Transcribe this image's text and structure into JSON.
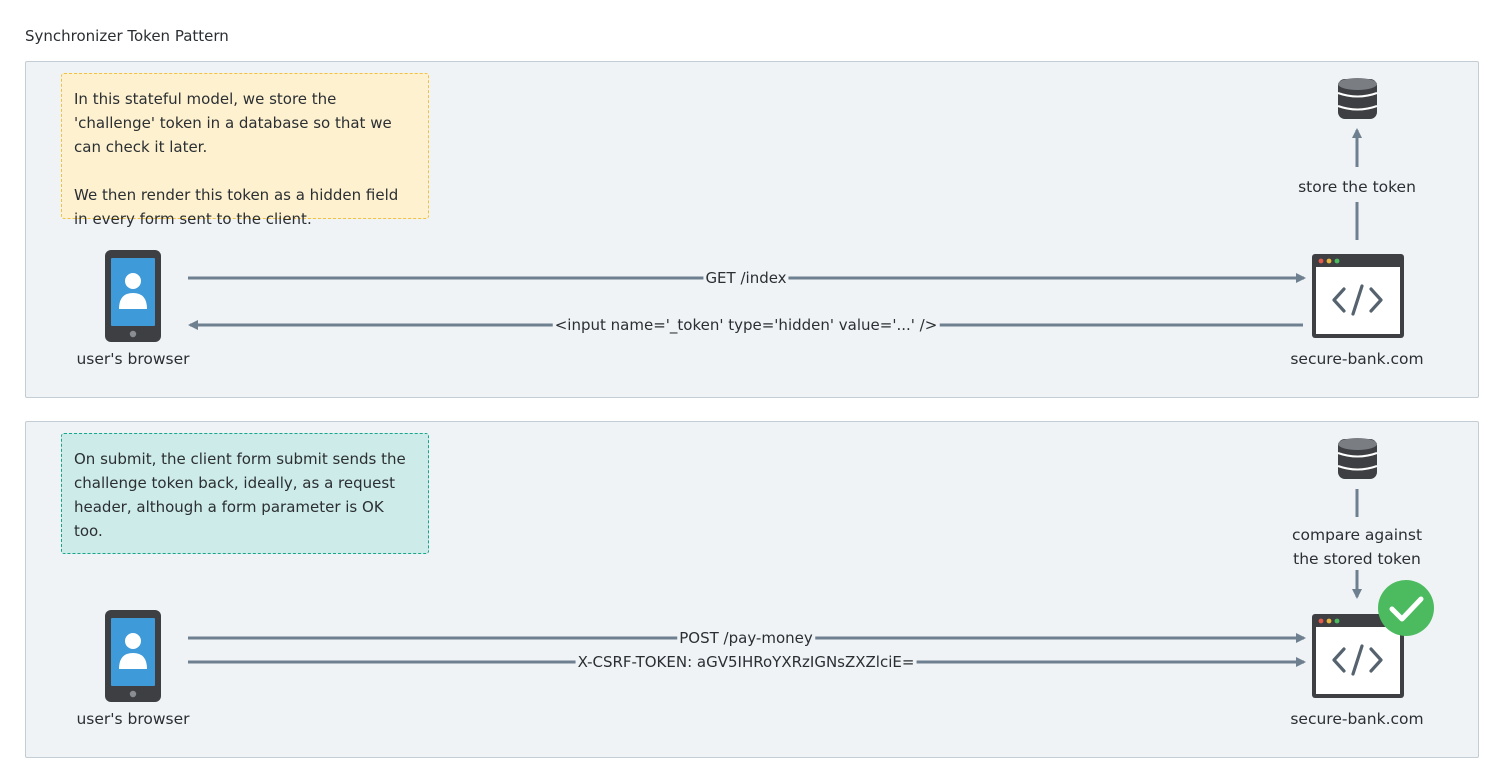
{
  "title": "Synchronizer Token Pattern",
  "panel1": {
    "note": [
      "In this stateful model, we store the 'challenge' token in a database so that we can check it later.",
      "We then render this token as a hidden field in every form sent to the client."
    ],
    "client_label": "user's browser",
    "server_label": "secure-bank.com",
    "store_label": "store the token",
    "request": "GET /index",
    "response": "<input name='_token' type='hidden' value='...' />"
  },
  "panel2": {
    "note": "On submit, the client form submit sends the challenge token back, ideally, as a request header, although a form parameter is OK too.",
    "client_label": "user's browser",
    "server_label": "secure-bank.com",
    "compare_label": "compare against\nthe stored token",
    "request": "POST /pay-money",
    "header": "X-CSRF-TOKEN: aGV5IHRoYXRzIGNsZXZlciE="
  },
  "colors": {
    "panel_bg": "#eff3f6",
    "arrow": "#6e7f90",
    "phone_body": "#3d3f42",
    "phone_screen": "#3e9ad8",
    "note_yellow": "#fdf1cf",
    "note_teal": "#cdebe8",
    "check": "#4cbb5f"
  }
}
